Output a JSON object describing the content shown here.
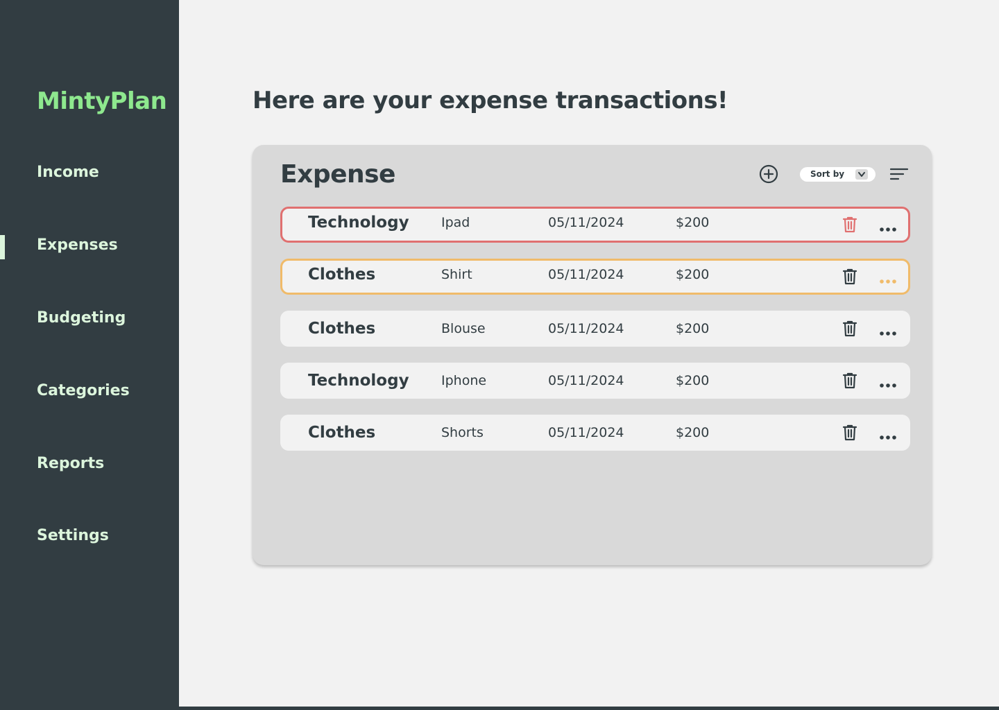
{
  "app": {
    "name": "MintyPlan"
  },
  "sidebar": {
    "items": [
      {
        "label": "Income"
      },
      {
        "label": "Expenses",
        "active": true
      },
      {
        "label": "Budgeting"
      },
      {
        "label": "Categories"
      },
      {
        "label": "Reports"
      },
      {
        "label": "Settings"
      }
    ]
  },
  "main": {
    "title": "Here are your expense transactions!",
    "panel": {
      "title": "Expense",
      "sort_label": "Sort by",
      "add_icon": "plus-circle-icon",
      "filter_icon": "filter-lines-icon",
      "rows": [
        {
          "category": "Technology",
          "item": "Ipad",
          "date": "05/11/2024",
          "amount": "$200",
          "state": "delete-hover"
        },
        {
          "category": "Clothes",
          "item": "Shirt",
          "date": "05/11/2024",
          "amount": "$200",
          "state": "more-hover"
        },
        {
          "category": "Clothes",
          "item": "Blouse",
          "date": "05/11/2024",
          "amount": "$200",
          "state": "normal"
        },
        {
          "category": "Technology",
          "item": "Iphone",
          "date": "05/11/2024",
          "amount": "$200",
          "state": "normal"
        },
        {
          "category": "Clothes",
          "item": "Shorts",
          "date": "05/11/2024",
          "amount": "$200",
          "state": "normal"
        }
      ]
    }
  },
  "colors": {
    "sidebar_bg": "#323d42",
    "brand": "#8ee88e",
    "nav_text": "#dcf5dc",
    "page_bg": "#f2f2f2",
    "panel_bg": "#d9d9d9",
    "danger": "#e07070",
    "warning": "#f0bb6a"
  }
}
